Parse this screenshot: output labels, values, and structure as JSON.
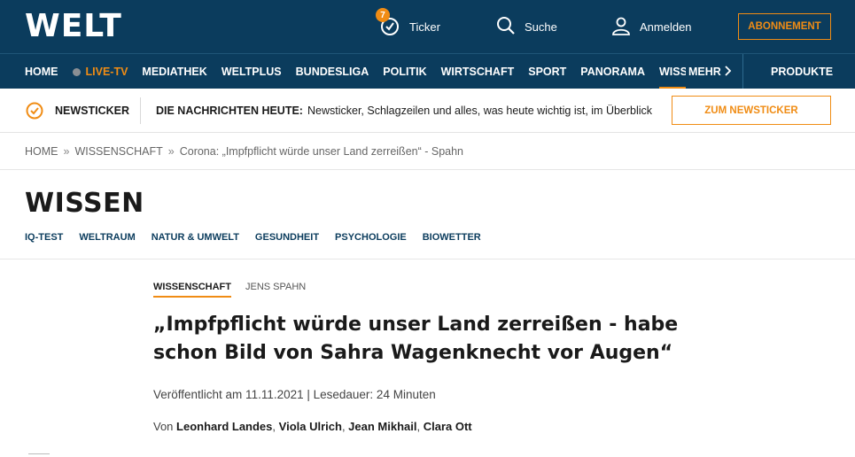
{
  "header": {
    "logo": "WELT",
    "ticker_label": "Ticker",
    "ticker_badge": "7",
    "search_label": "Suche",
    "login_label": "Anmelden",
    "subscribe_label": "ABONNEMENT",
    "accent_color": "#f08c14",
    "brand_color": "#0b3c5d"
  },
  "nav": {
    "items": [
      "HOME",
      "LIVE-TV",
      "MEDIATHEK",
      "WELTPLUS",
      "BUNDESLIGA",
      "POLITIK",
      "WIRTSCHAFT",
      "SPORT",
      "PANORAMA",
      "WISS"
    ],
    "more_label": "MEHR",
    "products_label": "PRODUKTE"
  },
  "newsbar": {
    "label": "NEWSTICKER",
    "headline_prefix": "DIE NACHRICHTEN HEUTE:",
    "headline_text": "Newsticker, Schlagzeilen und alles, was heute wichtig ist, im Überblick",
    "button_label": "ZUM NEWSTICKER"
  },
  "breadcrumb": {
    "items": [
      "HOME",
      "WISSENSCHAFT",
      "Corona: „Impfpflicht würde unser Land zerreißen“ - Spahn"
    ],
    "separator": "»"
  },
  "section": {
    "title": "WISSEN",
    "subnav": [
      "IQ-TEST",
      "WELTRAUM",
      "NATUR & UMWELT",
      "GESUNDHEIT",
      "PSYCHOLOGIE",
      "BIOWETTER"
    ]
  },
  "article": {
    "topic_primary": "WISSENSCHAFT",
    "topic_secondary": "JENS SPAHN",
    "headline": "„Impfpflicht würde unser Land zerreißen - habe schon Bild von Sahra Wagenknecht vor Augen“",
    "meta": "Veröffentlicht am 11.11.2021 | Lesedauer: 24 Minuten",
    "authors_prefix": "Von",
    "authors": [
      "Leonhard Landes",
      "Viola Ulrich",
      "Jean Mikhail",
      "Clara Ott"
    ]
  }
}
